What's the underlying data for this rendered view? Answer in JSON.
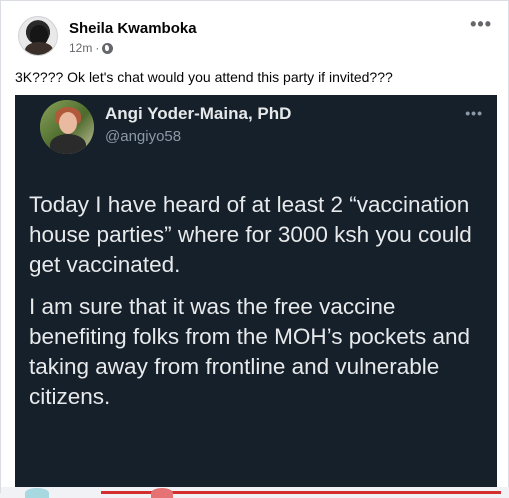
{
  "post": {
    "author": "Sheila Kwamboka",
    "time": "12m",
    "separator": "·",
    "more": "•••",
    "text": "3K???? Ok let's chat would you attend this party if invited???"
  },
  "tweet": {
    "name": "Angi Yoder-Maina, PhD",
    "handle": "@angiyo58",
    "more": "•••",
    "paragraph_1": "Today I have heard of at least 2 “vaccination house parties” where for 3000 ksh you could get vaccinated.",
    "paragraph_2": "I am sure that it was the free vaccine benefiting folks from the MOH’s pockets and taking away from frontline and vulnerable citizens."
  },
  "icons": {
    "audience": "globe-icon",
    "options": "more-options-icon"
  },
  "colors": {
    "tweet_background": "#15202b",
    "tweet_text": "#e7e9ea",
    "tweet_handle": "#8b98a5",
    "post_meta": "#65676b"
  }
}
